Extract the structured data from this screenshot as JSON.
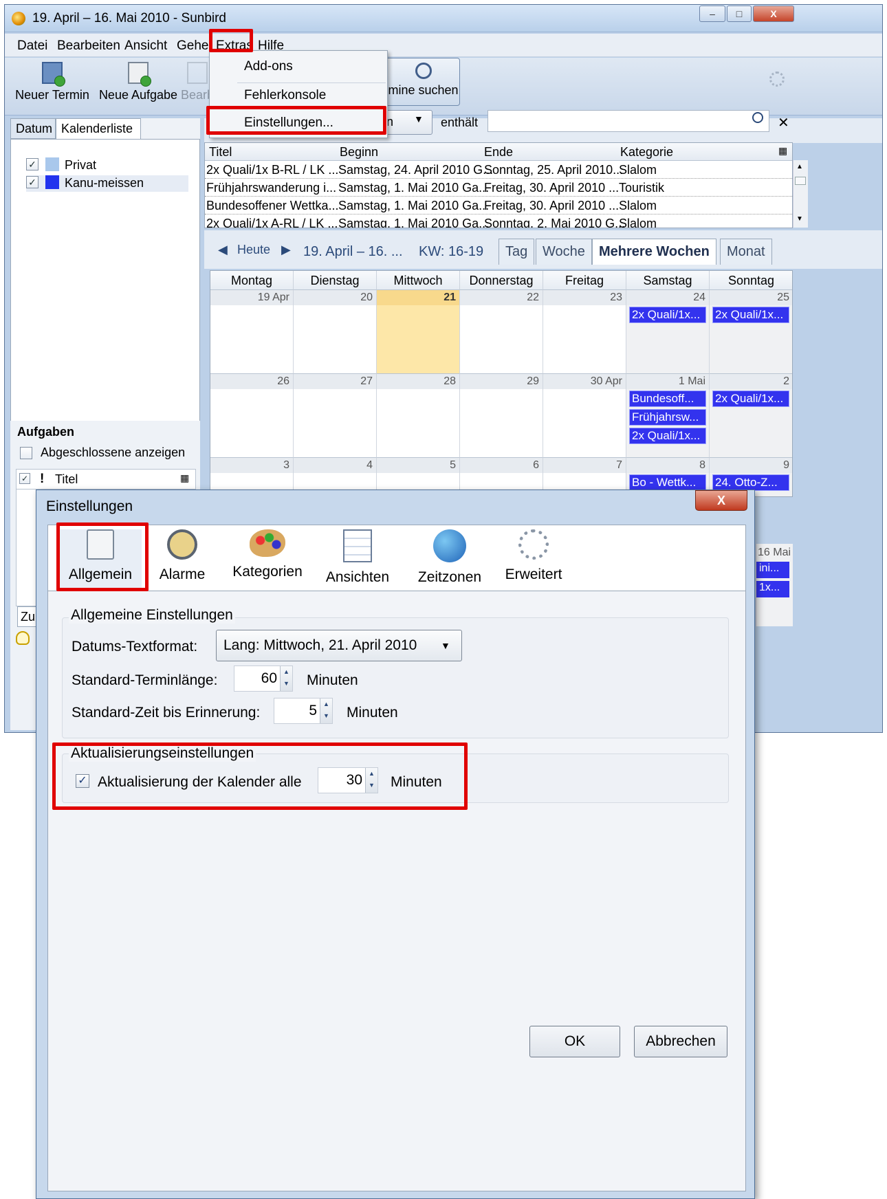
{
  "window": {
    "title": "19. April – 16. Mai 2010 - Sunbird",
    "min": "–",
    "max": "□",
    "close": "X"
  },
  "menu": [
    "Datei",
    "Bearbeiten",
    "Ansicht",
    "Gehe",
    "Extras",
    "Hilfe"
  ],
  "toolbar": {
    "new_event": "Neuer Termin",
    "new_task": "Neue Aufgabe",
    "edit": "Bearb",
    "find": "mine suchen"
  },
  "extras_menu": {
    "addons": "Add-ons",
    "console": "Fehlerkonsole",
    "settings": "Einstellungen..."
  },
  "left": {
    "tab_datum": "Datum",
    "tab_kalenderliste": "Kalenderliste",
    "calendars": [
      {
        "name": "Privat",
        "color": "#a9c8ec",
        "checked": "✓"
      },
      {
        "name": "Kanu-meissen",
        "color": "#2233ee",
        "checked": "✓"
      }
    ],
    "tasks_title": "Aufgaben",
    "show_completed": "Abgeschlossene anzeigen",
    "task_col_title": "Titel",
    "task_excl": "!",
    "task_check": "✓",
    "add_task_partial": "Zu"
  },
  "search": {
    "filter_partial": "n",
    "contains": "enthält"
  },
  "events": {
    "headers": [
      "Titel",
      "Beginn",
      "Ende",
      "Kategorie"
    ],
    "rows": [
      [
        "2x Quali/1x B-RL  / LK ...",
        "Samstag, 24. April 2010 G...",
        "Sonntag, 25. April 2010...",
        "Slalom"
      ],
      [
        "Frühjahrswanderung i...",
        "Samstag, 1. Mai 2010 Ga...",
        "Freitag, 30. April 2010 ...",
        "Touristik"
      ],
      [
        "Bundesoffener Wettka...",
        "Samstag, 1. Mai 2010 Ga...",
        "Freitag, 30. April 2010 ...",
        "Slalom"
      ],
      [
        "2x Quali/1x A-RL  / LK ...",
        "Samstag, 1. Mai 2010 Ga...",
        "Sonntag, 2. Mai 2010 G...",
        "Slalom"
      ]
    ]
  },
  "nav": {
    "today": "Heute",
    "range": "19. April – 16. ...",
    "week": "KW: 16-19",
    "views": [
      "Tag",
      "Woche",
      "Mehrere Wochen",
      "Monat"
    ]
  },
  "calendar": {
    "days": [
      "Montag",
      "Dienstag",
      "Mittwoch",
      "Donnerstag",
      "Freitag",
      "Samstag",
      "Sonntag"
    ],
    "week1": [
      "19 Apr",
      "20",
      "21",
      "22",
      "23",
      "24",
      "25"
    ],
    "week2": [
      "26",
      "27",
      "28",
      "29",
      "30 Apr",
      "1 Mai",
      "2"
    ],
    "week3": [
      "3",
      "4",
      "5",
      "6",
      "7",
      "8",
      "9"
    ],
    "ev_w1_sat": "2x Quali/1x...",
    "ev_w1_sun": "2x Quali/1x...",
    "ev_w2_sat": [
      "Bundesoff...",
      "Frühjahrsw...",
      "2x Quali/1x..."
    ],
    "ev_w2_sun": "2x Quali/1x...",
    "ev_w3_sat": "Bo - Wettk...",
    "ev_w3_sun": "24. Otto-Z...",
    "w4_sun_label": "16 Mai",
    "w4_ev1": "ini...",
    "w4_ev2": "1x..."
  },
  "dialog": {
    "title": "Einstellungen",
    "close": "X",
    "panes": [
      "Allgemein",
      "Alarme",
      "Kategorien",
      "Ansichten",
      "Zeitzonen",
      "Erweitert"
    ],
    "general_group": "Allgemeine Einstellungen",
    "date_format_label": "Datums-Textformat:",
    "date_format_value": "Lang: Mittwoch, 21. April 2010",
    "event_length_label": "Standard-Terminlänge:",
    "event_length_value": "60",
    "reminder_label": "Standard-Zeit bis Erinnerung:",
    "reminder_value": "5",
    "minutes": "Minuten",
    "update_group": "Aktualisierungseinstellungen",
    "update_label": "Aktualisierung der Kalender alle",
    "update_value": "30",
    "update_checked": "✓",
    "ok": "OK",
    "cancel": "Abbrechen"
  }
}
